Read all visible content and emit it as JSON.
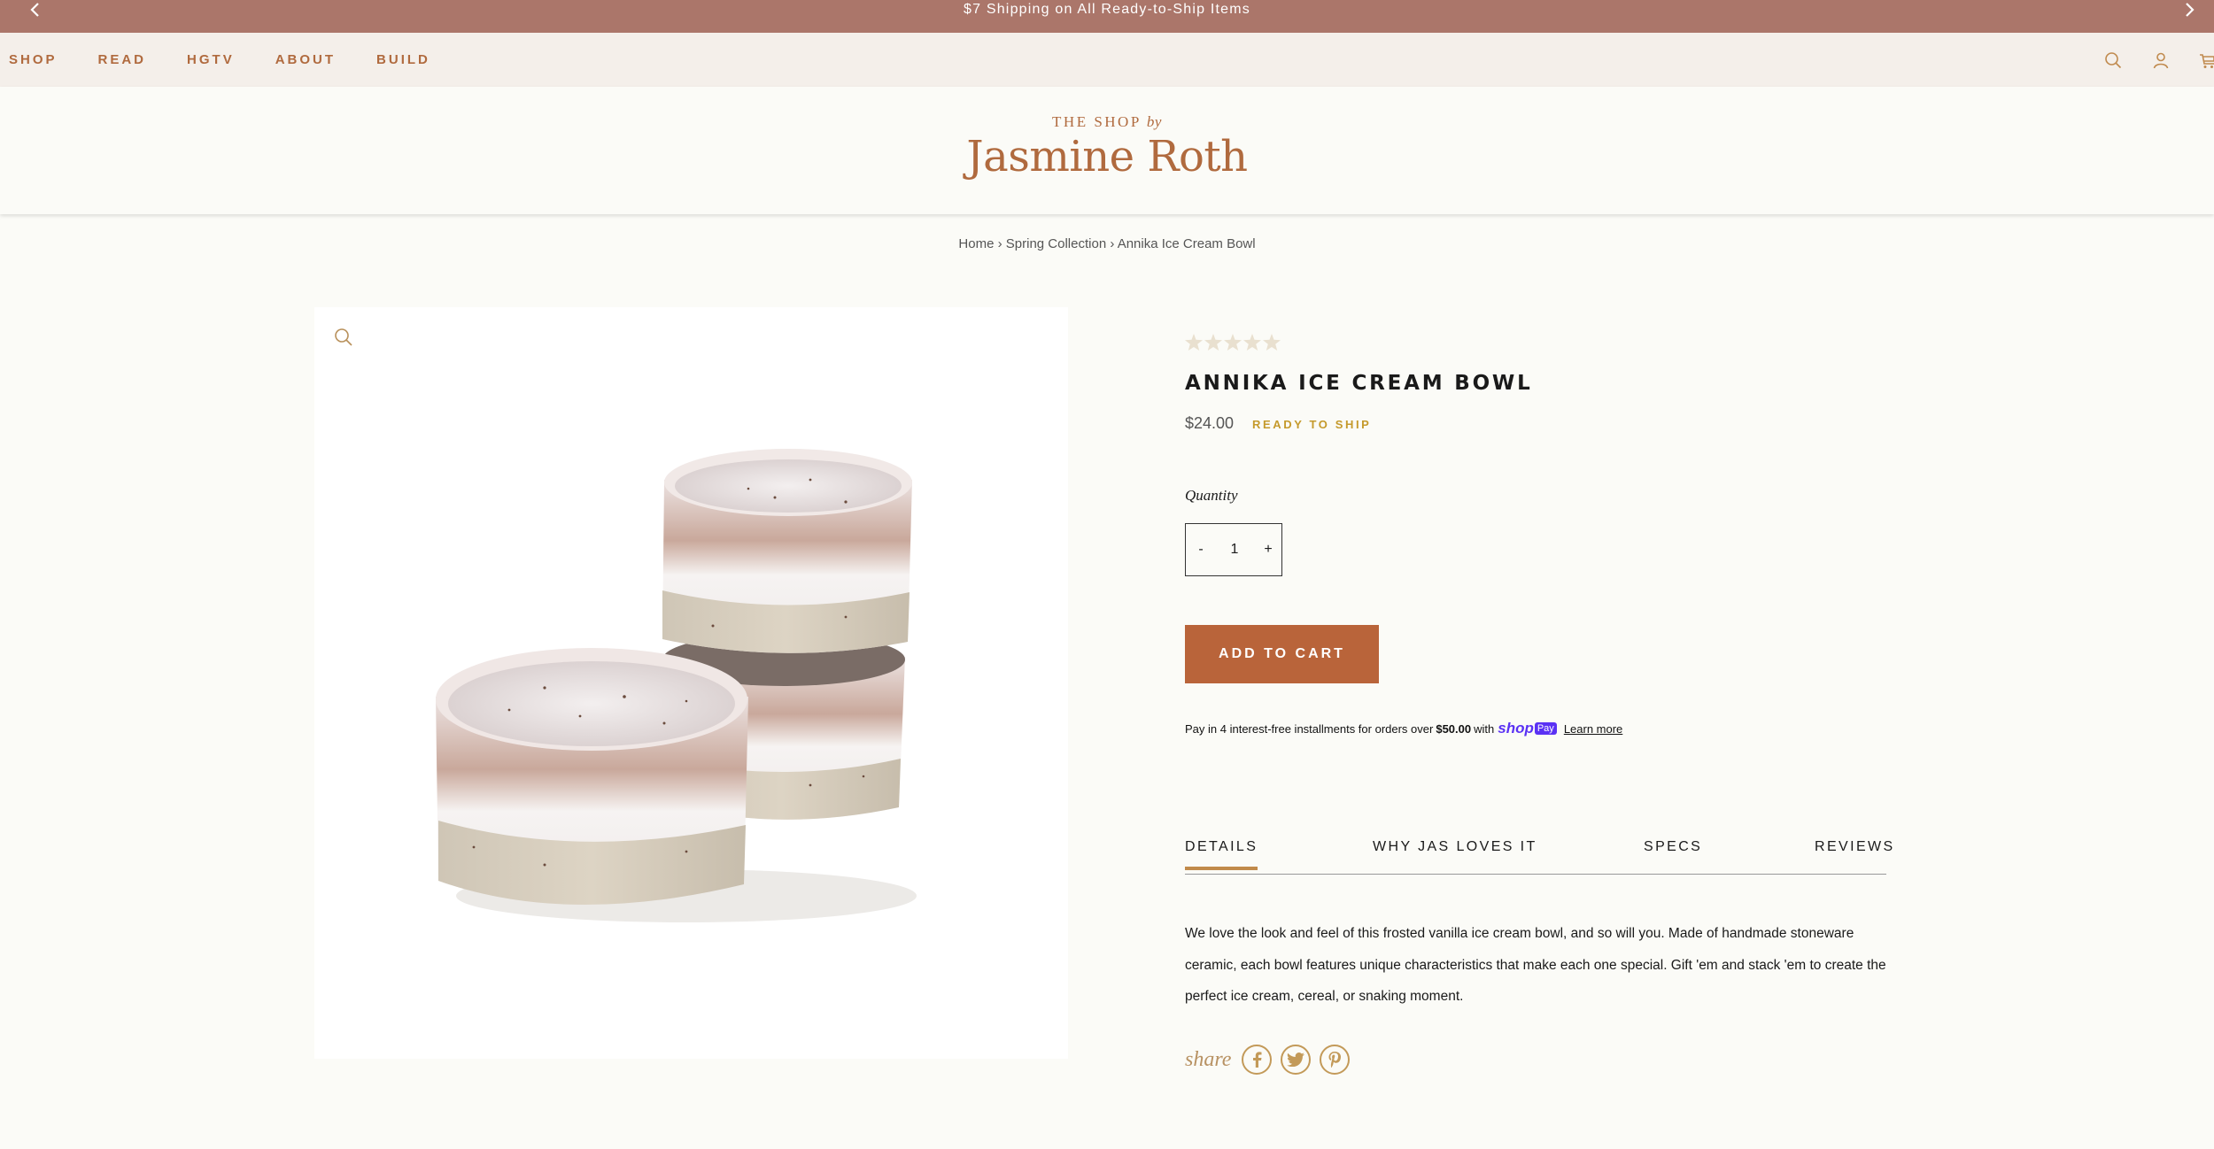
{
  "announcement": {
    "message": "$7 Shipping on All Ready-to-Ship Items"
  },
  "nav": {
    "items": [
      "SHOP",
      "READ",
      "HGTV",
      "ABOUT",
      "BUILD"
    ],
    "icons": [
      "search-icon",
      "account-icon",
      "cart-icon"
    ]
  },
  "logo": {
    "line1": "THE SHOP",
    "line1_by": "by",
    "line2": "Jasmine Roth"
  },
  "breadcrumb": {
    "home": "Home",
    "sep1": " › ",
    "collection": "Spring Collection",
    "sep2": " › ",
    "current": "Annika Ice Cream Bowl"
  },
  "product": {
    "rating_stars": 5,
    "title": "ANNIKA ICE CREAM BOWL",
    "price": "$24.00",
    "status": "READY TO SHIP",
    "quantity_label": "Quantity",
    "quantity_minus": "-",
    "quantity_value": "1",
    "quantity_plus": "+",
    "add_to_cart": "ADD TO CART"
  },
  "shop_pay": {
    "text": "Pay in 4 interest-free installments for orders over",
    "amount": "$50.00",
    "with": "with",
    "brand": "shop",
    "badge": "Pay",
    "learn_more": "Learn more"
  },
  "tabs": [
    "DETAILS",
    "WHY JAS LOVES IT",
    "SPECS",
    "REVIEWS"
  ],
  "details": {
    "line1": "We love the look and feel of this frosted vanilla ice cream bowl, and so will you. Made of handmade stoneware",
    "line2": "ceramic, each bowl features unique characteristics that make each one special. Gift 'em and stack 'em to create the",
    "line3": "perfect ice cream, cereal, or snaking moment."
  },
  "share": {
    "label": "share",
    "icons": [
      "facebook-icon",
      "twitter-icon",
      "pinterest-icon"
    ]
  },
  "colors": {
    "announcement_bg": "#ab766a",
    "brand": "#b06a3e",
    "button": "#b9643a",
    "accent_gold": "#c59a2c"
  }
}
